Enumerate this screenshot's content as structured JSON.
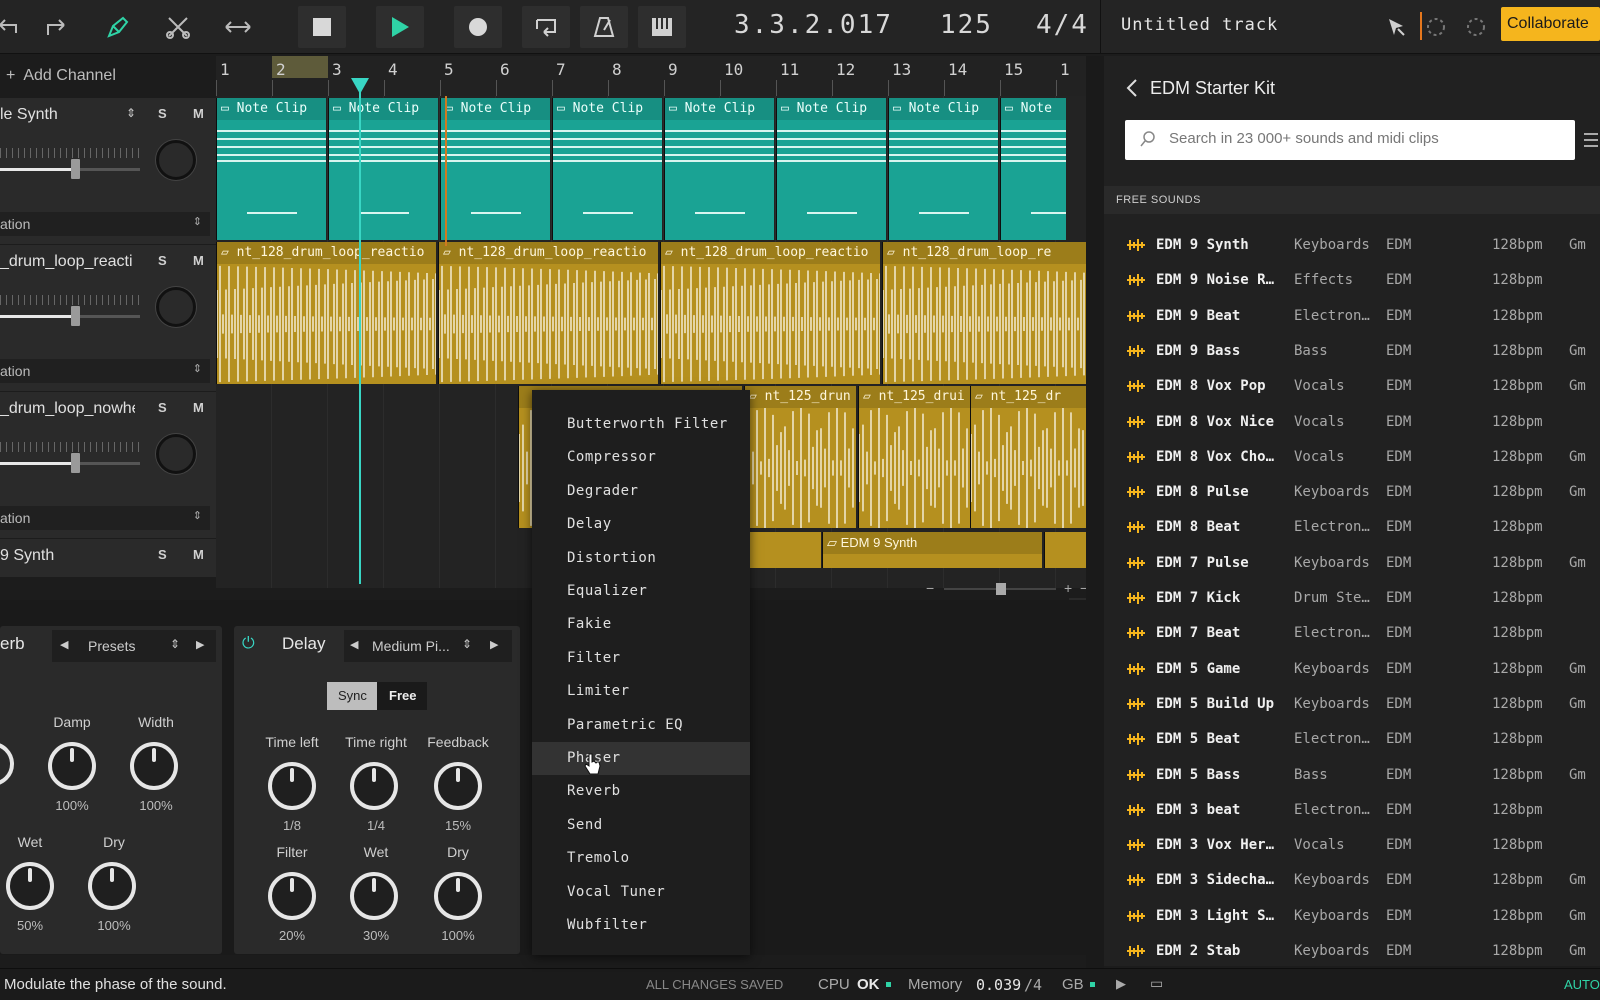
{
  "toolbar": {
    "position": "3.3.2.017",
    "tempo": "125",
    "time_signature": "4/4",
    "track_title": "Untitled track",
    "collaborate_label": "Collaborate"
  },
  "channels": {
    "add_label": "Add Channel",
    "items": [
      {
        "name": "le Synth",
        "s": "S",
        "m": "M",
        "automation": "ation"
      },
      {
        "name": "_drum_loop_reacti",
        "s": "S",
        "m": "M",
        "automation": "ation"
      },
      {
        "name": "_drum_loop_nowhe",
        "s": "S",
        "m": "M",
        "automation": "ation"
      },
      {
        "name": "9 Synth",
        "s": "S",
        "m": "M"
      }
    ]
  },
  "ruler": {
    "bars": [
      "1",
      "2",
      "3",
      "4",
      "5",
      "6",
      "7",
      "8",
      "9",
      "10",
      "11",
      "12",
      "13",
      "14",
      "15",
      "1"
    ]
  },
  "clips": {
    "note_label": "Note Clip",
    "note_label_short": "Note",
    "drum_reaction": "nt_128_drum_loop_reactio",
    "drum_reaction_last": "nt_128_drum_loop_re",
    "drum_125": "nt_125_drun",
    "drum_125_b": "nt_125_drui",
    "drum_125_c": "nt_125_dr",
    "synth_clip": "EDM 9 Synth"
  },
  "fx": {
    "reverb": {
      "title": "erb",
      "presets": "Presets",
      "knobs": [
        {
          "label": "Damp",
          "value": "100%"
        },
        {
          "label": "Width",
          "value": "100%"
        },
        {
          "label": "Wet",
          "value": "50%"
        },
        {
          "label": "Dry",
          "value": "100%"
        }
      ]
    },
    "delay": {
      "title": "Delay",
      "preset": "Medium Pi...",
      "sync": "Sync",
      "free": "Free",
      "knobs": [
        {
          "label": "Time left",
          "value": "1/8"
        },
        {
          "label": "Time right",
          "value": "1/4"
        },
        {
          "label": "Feedback",
          "value": "15%"
        },
        {
          "label": "Filter",
          "value": "20%"
        },
        {
          "label": "Wet",
          "value": "30%"
        },
        {
          "label": "Dry",
          "value": "100%"
        }
      ]
    }
  },
  "fx_menu": {
    "items": [
      "Butterworth Filter",
      "Compressor",
      "Degrader",
      "Delay",
      "Distortion",
      "Equalizer",
      "Fakie",
      "Filter",
      "Limiter",
      "Parametric EQ",
      "Phaser",
      "Reverb",
      "Send",
      "Tremolo",
      "Vocal Tuner",
      "Wubfilter"
    ],
    "active": "Phaser"
  },
  "browser": {
    "title": "EDM Starter Kit",
    "search_placeholder": "Search in 23 000+ sounds and midi clips",
    "section": "FREE SOUNDS",
    "sounds": [
      {
        "name": "EDM 9 Synth",
        "category": "Keyboards",
        "genre": "EDM",
        "bpm": "128bpm",
        "key": "Gm"
      },
      {
        "name": "EDM 9 Noise R…",
        "category": "Effects",
        "genre": "EDM",
        "bpm": "128bpm",
        "key": ""
      },
      {
        "name": "EDM 9 Beat",
        "category": "Electron…",
        "genre": "EDM",
        "bpm": "128bpm",
        "key": ""
      },
      {
        "name": "EDM 9 Bass",
        "category": "Bass",
        "genre": "EDM",
        "bpm": "128bpm",
        "key": "Gm"
      },
      {
        "name": "EDM 8 Vox Pop",
        "category": "Vocals",
        "genre": "EDM",
        "bpm": "128bpm",
        "key": "Gm"
      },
      {
        "name": "EDM 8 Vox Nice",
        "category": "Vocals",
        "genre": "EDM",
        "bpm": "128bpm",
        "key": ""
      },
      {
        "name": "EDM 8 Vox Cho…",
        "category": "Vocals",
        "genre": "EDM",
        "bpm": "128bpm",
        "key": "Gm"
      },
      {
        "name": "EDM 8 Pulse",
        "category": "Keyboards",
        "genre": "EDM",
        "bpm": "128bpm",
        "key": "Gm"
      },
      {
        "name": "EDM 8 Beat",
        "category": "Electron…",
        "genre": "EDM",
        "bpm": "128bpm",
        "key": ""
      },
      {
        "name": "EDM 7 Pulse",
        "category": "Keyboards",
        "genre": "EDM",
        "bpm": "128bpm",
        "key": "Gm"
      },
      {
        "name": "EDM 7 Kick",
        "category": "Drum Ste…",
        "genre": "EDM",
        "bpm": "128bpm",
        "key": ""
      },
      {
        "name": "EDM 7 Beat",
        "category": "Electron…",
        "genre": "EDM",
        "bpm": "128bpm",
        "key": ""
      },
      {
        "name": "EDM 5 Game",
        "category": "Keyboards",
        "genre": "EDM",
        "bpm": "128bpm",
        "key": "Gm"
      },
      {
        "name": "EDM 5 Build Up",
        "category": "Keyboards",
        "genre": "EDM",
        "bpm": "128bpm",
        "key": "Gm"
      },
      {
        "name": "EDM 5 Beat",
        "category": "Electron…",
        "genre": "EDM",
        "bpm": "128bpm",
        "key": ""
      },
      {
        "name": "EDM 5 Bass",
        "category": "Bass",
        "genre": "EDM",
        "bpm": "128bpm",
        "key": "Gm"
      },
      {
        "name": "EDM 3 beat",
        "category": "Electron…",
        "genre": "EDM",
        "bpm": "128bpm",
        "key": ""
      },
      {
        "name": "EDM 3 Vox Her…",
        "category": "Vocals",
        "genre": "EDM",
        "bpm": "128bpm",
        "key": ""
      },
      {
        "name": "EDM 3 Sidecha…",
        "category": "Keyboards",
        "genre": "EDM",
        "bpm": "128bpm",
        "key": "Gm"
      },
      {
        "name": "EDM 3 Light S…",
        "category": "Keyboards",
        "genre": "EDM",
        "bpm": "128bpm",
        "key": "Gm"
      },
      {
        "name": "EDM 2 Stab",
        "category": "Keyboards",
        "genre": "EDM",
        "bpm": "128bpm",
        "key": "Gm"
      }
    ]
  },
  "status": {
    "hint": "Modulate the phase of the sound.",
    "saved": "ALL CHANGES SAVED",
    "cpu_label": "CPU",
    "cpu_value": "OK",
    "memory_label": "Memory",
    "memory_value": "0.039",
    "memory_total": "/4",
    "memory_unit": "GB",
    "auto": "AUTO"
  },
  "colors": {
    "accent": "#1aa394",
    "gold": "#b5901f",
    "collaborate": "#f5b51d",
    "playhead": "#38d6c4"
  }
}
